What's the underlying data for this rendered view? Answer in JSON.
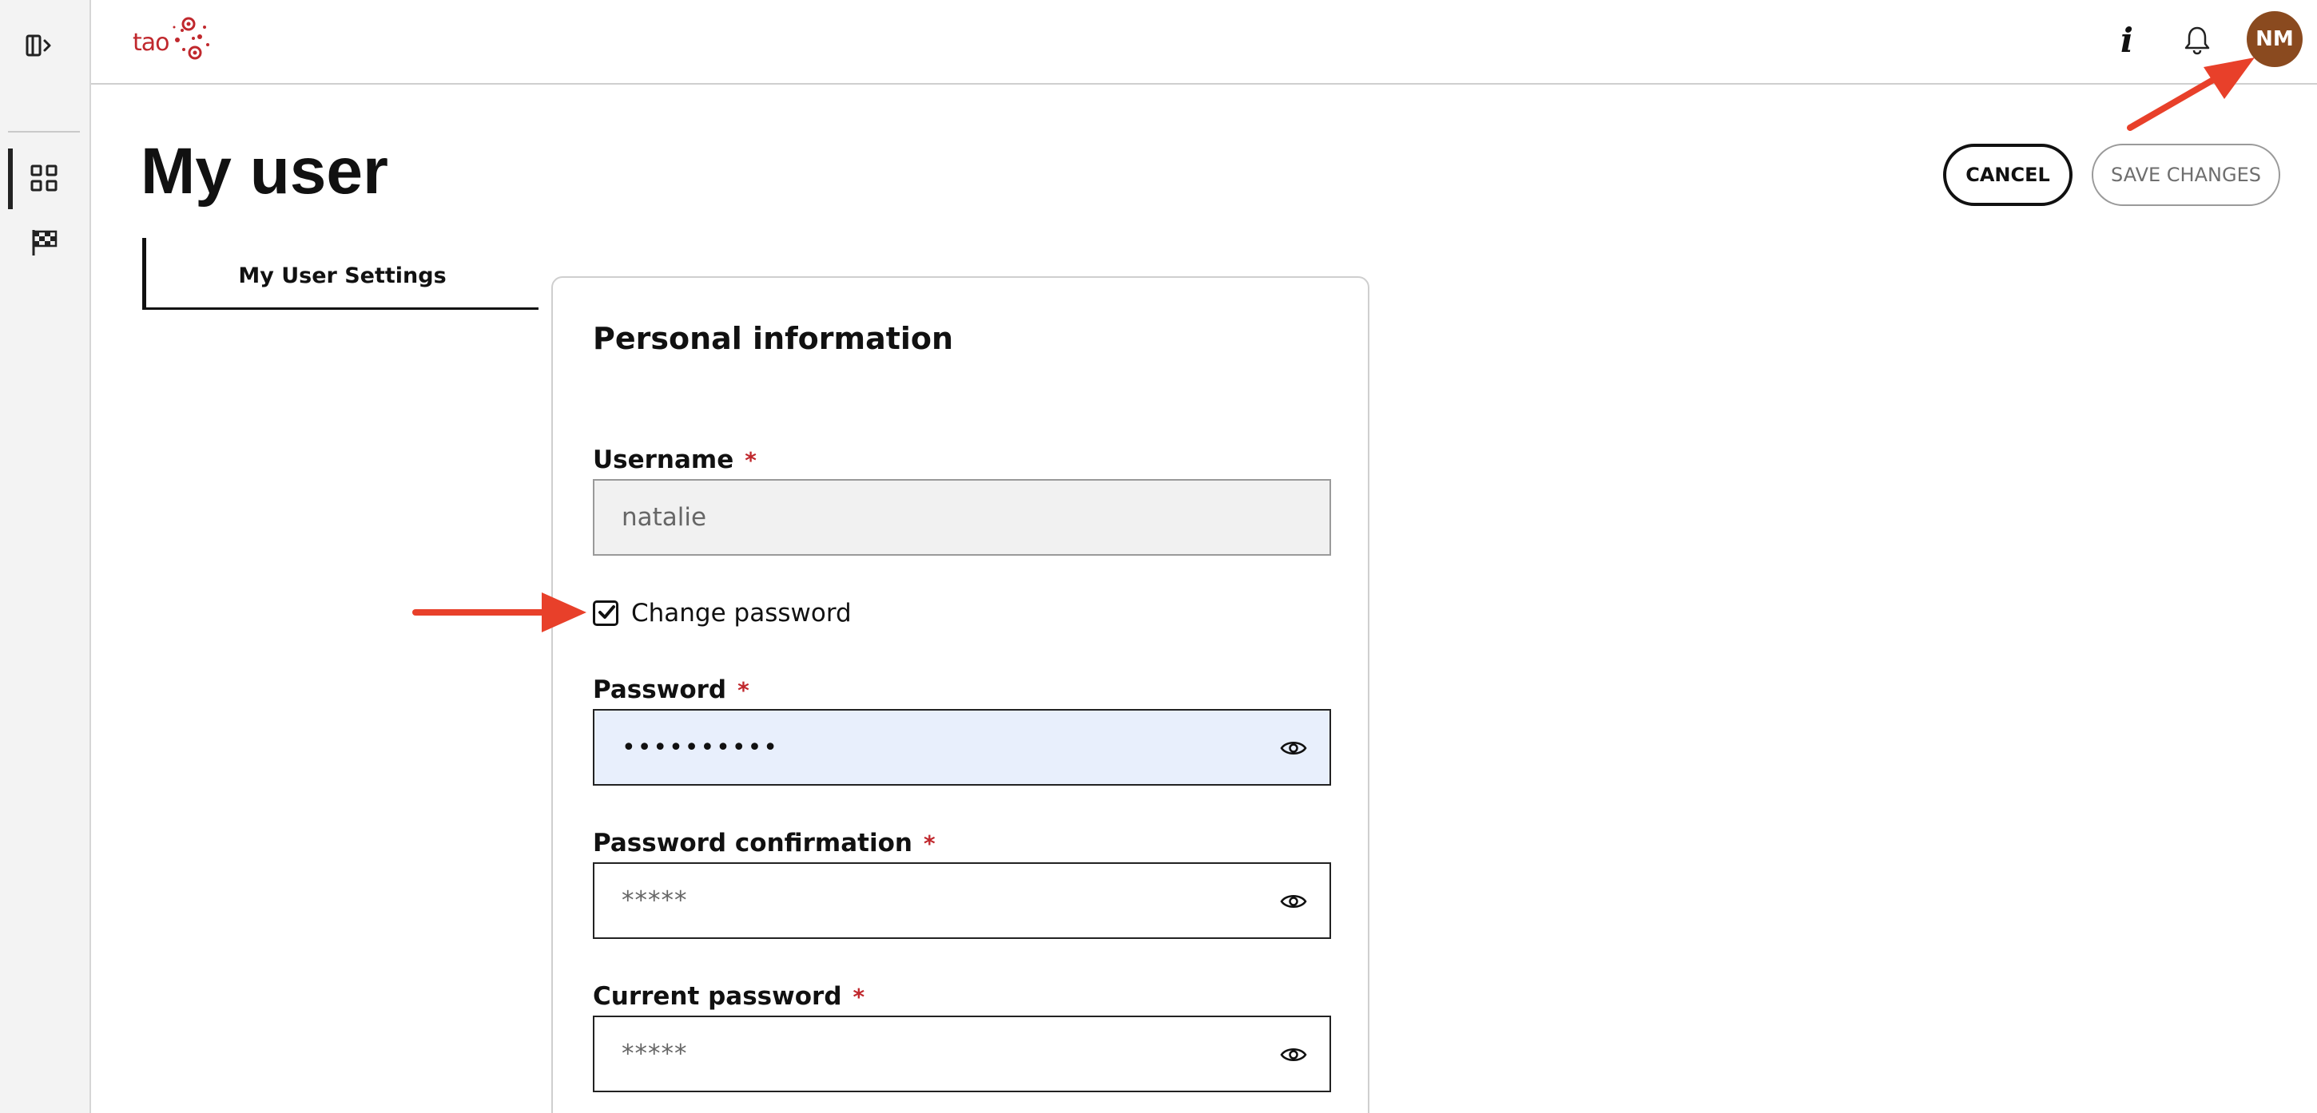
{
  "app": {
    "logo_text": "tao",
    "avatar_initials": "NM",
    "accent_color": "#c0282d",
    "avatar_color": "#8a4a1f"
  },
  "icons": {
    "rail_toggle": "sidebar-toggle-icon",
    "rail_dashboard": "grid-icon",
    "rail_results": "checkered-flag-icon",
    "info": "info-icon",
    "notifications": "bell-icon",
    "password_visibility": "eye-icon",
    "checkbox": "checkmark-icon"
  },
  "header": {
    "info_glyph": "i",
    "title": "My user",
    "cancel_label": "CANCEL",
    "save_label": "SAVE CHANGES"
  },
  "tabs": [
    {
      "label": "My User Settings",
      "active": true
    }
  ],
  "form": {
    "section_title": "Personal information",
    "required_marker": "*",
    "username": {
      "label": "Username",
      "value": "natalie",
      "readonly": true
    },
    "change_password": {
      "label": "Change password",
      "checked": true
    },
    "password": {
      "label": "Password",
      "value": "••••••••••"
    },
    "password_confirmation": {
      "label": "Password confirmation",
      "placeholder": "*****"
    },
    "current_password": {
      "label": "Current password",
      "placeholder": "*****"
    }
  },
  "annotations": {
    "arrow_color": "#e8402a"
  }
}
